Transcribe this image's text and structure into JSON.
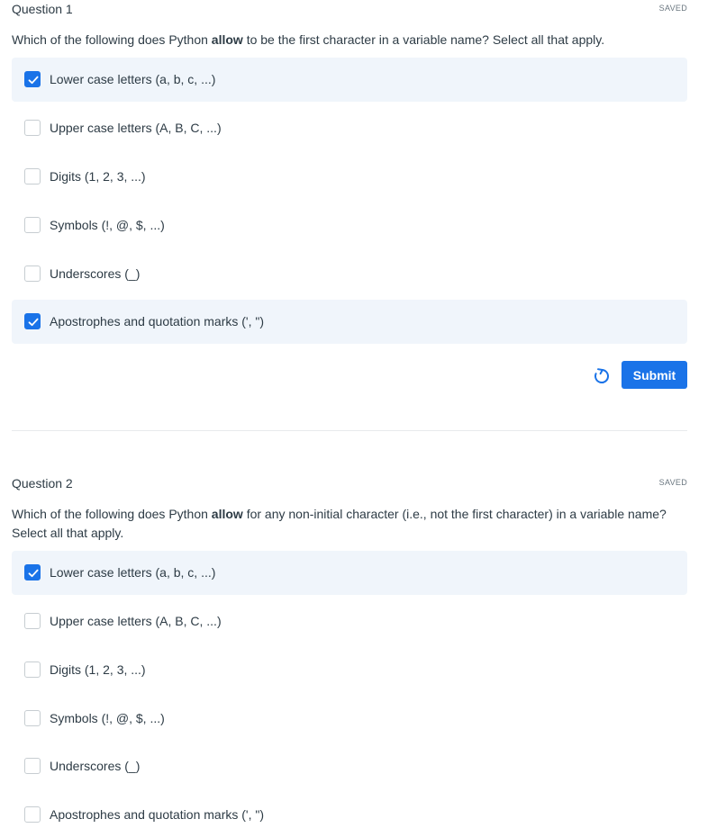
{
  "q1": {
    "title": "Question 1",
    "status": "SAVED",
    "prompt_pre": "Which of the following does Python ",
    "prompt_bold": "allow",
    "prompt_post": " to be the first character in a variable name? Select all that apply.",
    "options": [
      {
        "label": "Lower case letters (a, b, c, ...)",
        "checked": true
      },
      {
        "label": "Upper case letters (A, B, C, ...)",
        "checked": false
      },
      {
        "label": "Digits (1, 2, 3, ...)",
        "checked": false
      },
      {
        "label": "Symbols (!, @, $, ...)",
        "checked": false
      },
      {
        "label": "Underscores (_)",
        "checked": false
      },
      {
        "label": "Apostrophes and quotation marks (', \")",
        "checked": true
      }
    ],
    "reset_icon": "reset-icon",
    "submit_label": "Submit"
  },
  "q2": {
    "title": "Question 2",
    "status": "SAVED",
    "prompt_pre": "Which of the following does Python ",
    "prompt_bold": "allow",
    "prompt_post": " for any non-initial character (i.e., not the first character)  in a variable name? Select all that apply.",
    "options": [
      {
        "label": "Lower case letters (a, b, c, ...)",
        "checked": true
      },
      {
        "label": "Upper case letters (A, B, C, ...)",
        "checked": false
      },
      {
        "label": "Digits (1, 2, 3, ...)",
        "checked": false
      },
      {
        "label": "Symbols (!, @, $, ...)",
        "checked": false
      },
      {
        "label": "Underscores (_)",
        "checked": false
      },
      {
        "label": "Apostrophes and quotation marks (', \")",
        "checked": false
      }
    ]
  },
  "colors": {
    "accent": "#1a73e8",
    "selected_bg": "#f0f5fb",
    "text": "#2d3b45",
    "muted": "#6b7780"
  }
}
